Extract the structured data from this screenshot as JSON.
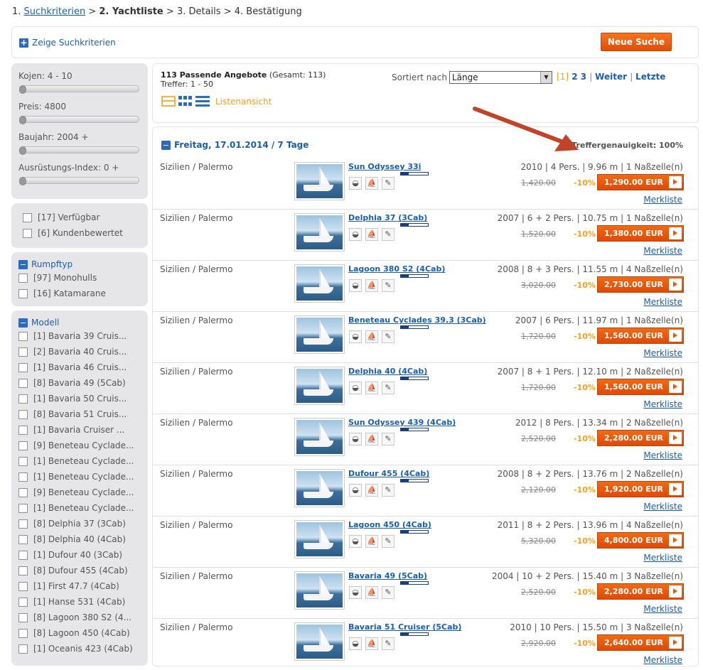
{
  "breadcrumb": {
    "step1_num": "1.",
    "step1_link": "Suchkriterien",
    "sep1": ">",
    "step2": "2. Yachtliste",
    "sep2": ">",
    "step3": "3. Details",
    "sep3": ">",
    "step4": "4. Bestätigung"
  },
  "topbar": {
    "show_criteria": "Zeige Suchkriterien",
    "new_search": "Neue Suche"
  },
  "sliders": [
    {
      "label": "Kojen: 4 - 10"
    },
    {
      "label": "Preis: 4800"
    },
    {
      "label": "Baujahr: 2004 +"
    },
    {
      "label": "Ausrüstungs-Index: 0 +"
    }
  ],
  "availability": [
    {
      "label": "[17] Verfügbar"
    },
    {
      "label": "[6] Kundenbewertet"
    }
  ],
  "hull": {
    "title": "Rumpftyp",
    "items": [
      {
        "label": "[97] Monohulls"
      },
      {
        "label": "[16] Katamarane"
      }
    ]
  },
  "model": {
    "title": "Modell",
    "items": [
      {
        "label": "[1] Bavaria 39 Cruis..."
      },
      {
        "label": "[2] Bavaria 40 Cruis..."
      },
      {
        "label": "[1] Bavaria 46 Cruis..."
      },
      {
        "label": "[8] Bavaria 49 (5Cab)"
      },
      {
        "label": "[1] Bavaria 50 Cruis..."
      },
      {
        "label": "[8] Bavaria 51 Cruis..."
      },
      {
        "label": "[1] Bavaria Cruiser ..."
      },
      {
        "label": "[9] Beneteau Cyclade..."
      },
      {
        "label": "[1] Beneteau Cyclade..."
      },
      {
        "label": "[1] Beneteau Cyclade..."
      },
      {
        "label": "[9] Beneteau Cyclade..."
      },
      {
        "label": "[1] Beneteau Cyclade..."
      },
      {
        "label": "[8] Delphia 37 (3Cab)"
      },
      {
        "label": "[8] Delphia 40 (4Cab)"
      },
      {
        "label": "[1] Dufour 40 (3Cab)"
      },
      {
        "label": "[8] Dufour 455 (4Cab)"
      },
      {
        "label": "[1] First 47.7 (4Cab)"
      },
      {
        "label": "[1] Hanse 531 (4Cab)"
      },
      {
        "label": "[8] Lagoon 380 S2 (4..."
      },
      {
        "label": "[8] Lagoon 450 (4Cab)"
      },
      {
        "label": "[1] Oceanis 423 (4Cab)"
      }
    ]
  },
  "results_head": {
    "count": "113 Passende Angebote",
    "total": " (Gesamt: 113)",
    "hits": "Treffer: 1 - 50",
    "sort_label": "Sortiert nach",
    "sort_value": "Länge",
    "page_current": "[1]",
    "page_2": "2",
    "page_3": "3",
    "next": "Weiter",
    "last": "Letzte",
    "list_view": "Listenansicht"
  },
  "results": {
    "date_title": "Freitag, 17.01.2014 / 7 Tage",
    "accuracy": "Treffergenauigkeit: 100%",
    "merk_label": "Merkliste",
    "discount": "-10%",
    "rows": [
      {
        "loc": "Sizilien / Palermo",
        "name": "Sun Odyssey 33i",
        "specs": "2010 | 4 Pers. | 9.96 m | 1 Naßzelle(n)",
        "old": "1,420.00",
        "price": "1,290.00 EUR",
        "rating": 0.3
      },
      {
        "loc": "Sizilien / Palermo",
        "name": "Delphia 37 (3Cab)",
        "specs": "2007 | 6 + 2 Pers. | 10.75 m | 1 Naßzelle(n)",
        "old": "1,520.00",
        "price": "1,380.00 EUR",
        "rating": 0.3
      },
      {
        "loc": "Sizilien / Palermo",
        "name": "Lagoon 380 S2 (4Cab)",
        "specs": "2008 | 8 + 3 Pers. | 11.55 m | 4 Naßzelle(n)",
        "old": "3,020.00",
        "price": "2,730.00 EUR",
        "rating": 0.3
      },
      {
        "loc": "Sizilien / Palermo",
        "name": "Beneteau Cyclades 39.3 (3Cab)",
        "specs": "2007 | 6 Pers. | 11.97 m | 1 Naßzelle(n)",
        "old": "1,720.00",
        "price": "1,560.00 EUR",
        "rating": 0.3
      },
      {
        "loc": "Sizilien / Palermo",
        "name": "Delphia 40 (4Cab)",
        "specs": "2007 | 8 + 1 Pers. | 12.10 m | 2 Naßzelle(n)",
        "old": "1,720.00",
        "price": "1,560.00 EUR",
        "rating": 0.3
      },
      {
        "loc": "Sizilien / Palermo",
        "name": "Sun Odyssey 439 (4Cab)",
        "specs": "2012 | 8 Pers. | 13.34 m | 2 Naßzelle(n)",
        "old": "2,520.00",
        "price": "2,280.00 EUR",
        "rating": 0.3
      },
      {
        "loc": "Sizilien / Palermo",
        "name": "Dufour 455 (4Cab)",
        "specs": "2008 | 8 + 2 Pers. | 13.76 m | 2 Naßzelle(n)",
        "old": "2,120.00",
        "price": "1,920.00 EUR",
        "rating": 0.3
      },
      {
        "loc": "Sizilien / Palermo",
        "name": "Lagoon 450 (4Cab)",
        "specs": "2011 | 8 + 2 Pers. | 13.96 m | 4 Naßzelle(n)",
        "old": "5,320.00",
        "price": "4,800.00 EUR",
        "rating": 0.3
      },
      {
        "loc": "Sizilien / Palermo",
        "name": "Bavaria 49 (5Cab)",
        "specs": "2004 | 10 + 2 Pers. | 15.40 m | 3 Naßzelle(n)",
        "old": "2,520.00",
        "price": "2,280.00 EUR",
        "rating": 0.3
      },
      {
        "loc": "Sizilien / Palermo",
        "name": "Bavaria 51 Cruiser (5Cab)",
        "specs": "2010 | 10 Pers. | 15.50 m | 3 Naßzelle(n)",
        "old": "2,920.00",
        "price": "2,640.00 EUR",
        "rating": 0.3
      }
    ]
  },
  "colors": {
    "link": "#1c5fa8",
    "accent_orange": "#e5590d",
    "discount": "#f0a01e",
    "annotation_arrow": "#c0432a"
  }
}
